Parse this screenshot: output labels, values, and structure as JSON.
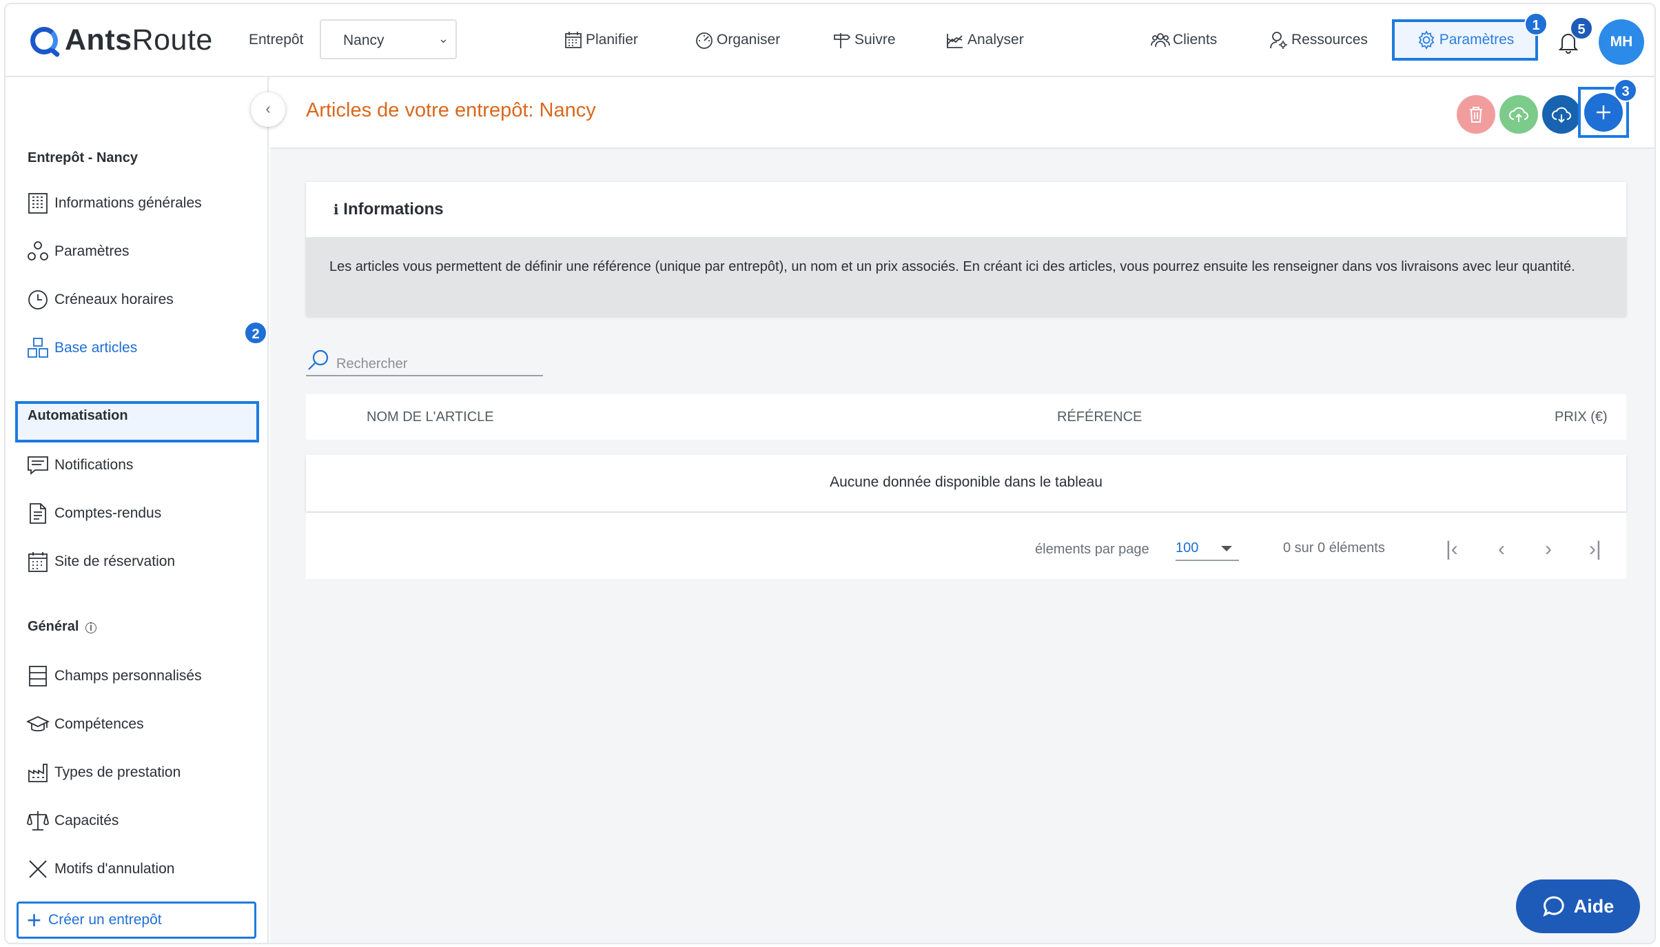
{
  "header": {
    "logo_text_bold": "Ants",
    "logo_text_rest": "Route",
    "warehouse_label": "Entrepôt",
    "warehouse_value": "Nancy",
    "nav": {
      "plan": "Planifier",
      "organize": "Organiser",
      "track": "Suivre",
      "analyze": "Analyser",
      "clients": "Clients",
      "resources": "Ressources",
      "settings": "Paramètres"
    },
    "notification_count": "5",
    "avatar_initials": "MH"
  },
  "annotations": {
    "one": "1",
    "two": "2",
    "three": "3"
  },
  "sidebar": {
    "section_warehouse": "Entrepôt - Nancy",
    "items_warehouse": {
      "general": "Informations générales",
      "settings": "Paramètres",
      "slots": "Créneaux horaires",
      "articles": "Base articles"
    },
    "section_automation": "Automatisation",
    "items_automation": {
      "notifications": "Notifications",
      "reports": "Comptes-rendus",
      "booking": "Site de réservation"
    },
    "section_general": "Général",
    "items_general": {
      "custom_fields": "Champs personnalisés",
      "skills": "Compétences",
      "service_types": "Types de prestation",
      "capacities": "Capacités",
      "cancel_reasons": "Motifs d'annulation"
    },
    "create_label": "Créer un entrepôt"
  },
  "main": {
    "title": "Articles de votre entrepôt: Nancy",
    "info": {
      "heading": "Informations",
      "text": "Les articles vous permettent de définir une référence (unique par entrepôt), un nom et un prix associés. En créant ici des articles, vous pourrez ensuite les renseigner dans vos livraisons avec leur quantité."
    },
    "search_placeholder": "Rechercher",
    "table": {
      "columns": [
        "NOM DE L'ARTICLE",
        "RÉFÉRENCE",
        "PRIX (€)"
      ],
      "empty_message": "Aucune donnée disponible dans le tableau",
      "per_page_label": "élements par page",
      "per_page_value": "100",
      "count_label": "0 sur 0 éléments"
    }
  },
  "help_label": "Aide",
  "colors": {
    "accent": "#1e7ae0",
    "title_orange": "#d9681d",
    "delete_btn": "#ee8a8a",
    "upload_btn": "#7ccb8a",
    "download_btn": "#1763b0",
    "add_btn": "#1e6fd6"
  }
}
